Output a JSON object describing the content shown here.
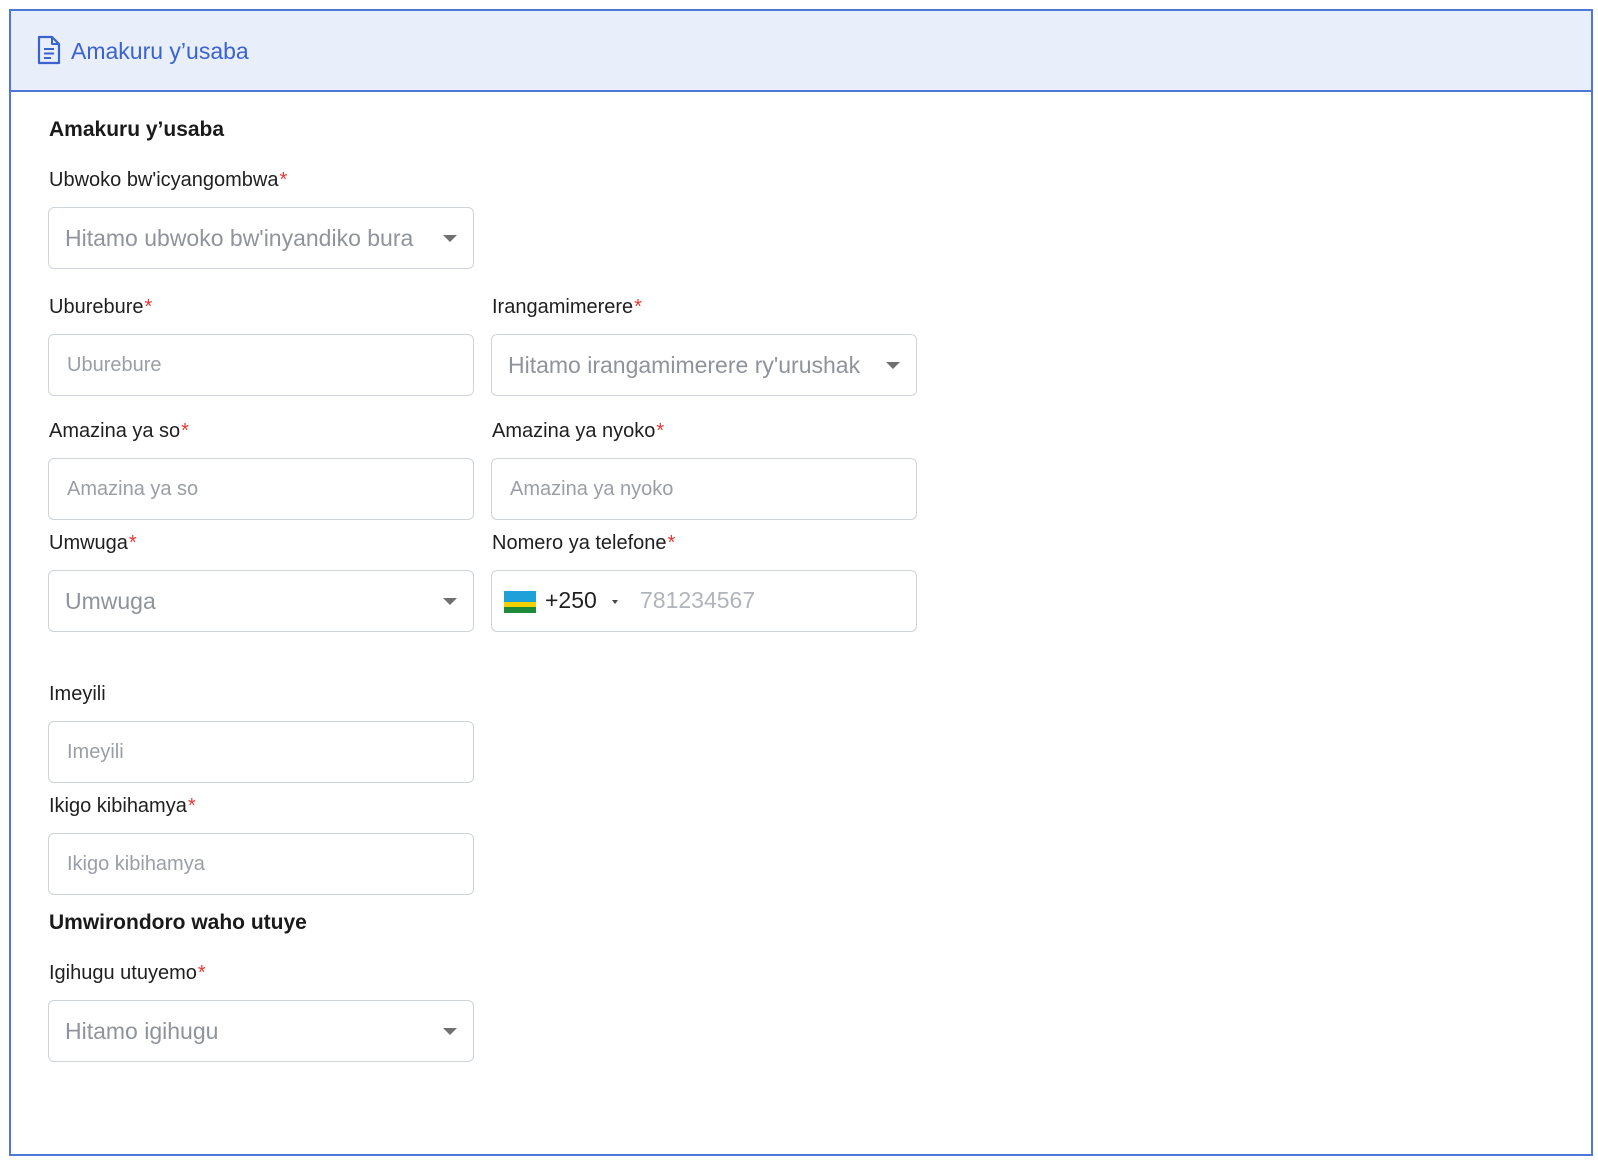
{
  "panel": {
    "title": "Amakuru y’usaba",
    "icon": "document-icon",
    "accent": "#4f76d9",
    "header_bg": "#e8eefa"
  },
  "section_applicant": {
    "title": "Amakuru y’usaba"
  },
  "fields": {
    "document_type": {
      "label": "Ubwoko bw'icyangombwa",
      "required_mark": "*",
      "placeholder": "Hitamo ubwoko bw'inyandiko bura"
    },
    "dob": {
      "label": "Uburebure",
      "required_mark": "*",
      "placeholder": "Uburebure"
    },
    "eye_color": {
      "label": "Irangamimerere",
      "required_mark": "*",
      "placeholder": "Hitamo irangamimerere ry'urushak"
    },
    "father_name": {
      "label": "Amazina ya so",
      "required_mark": "*",
      "placeholder": "Amazina ya so"
    },
    "mother_name": {
      "label": "Amazina ya nyoko",
      "required_mark": "*",
      "placeholder": "Amazina ya nyoko"
    },
    "occupation": {
      "label": "Umwuga",
      "required_mark": "*",
      "placeholder": "Umwuga"
    },
    "phone": {
      "label": "Nomero ya telefone",
      "required_mark": "*",
      "dial_code": "+250",
      "placeholder": "781234567",
      "flag": "rwanda-flag"
    },
    "email": {
      "label": "Imeyili",
      "placeholder": "Imeyili"
    },
    "issuing_institution": {
      "label": "Ikigo kibihamya",
      "required_mark": "*",
      "placeholder": "Ikigo kibihamya"
    },
    "country_of_residence": {
      "label": "Igihugu utuyemo",
      "required_mark": "*",
      "placeholder": "Hitamo igihugu"
    }
  },
  "section_address": {
    "title": "Umwirondoro waho utuye"
  }
}
